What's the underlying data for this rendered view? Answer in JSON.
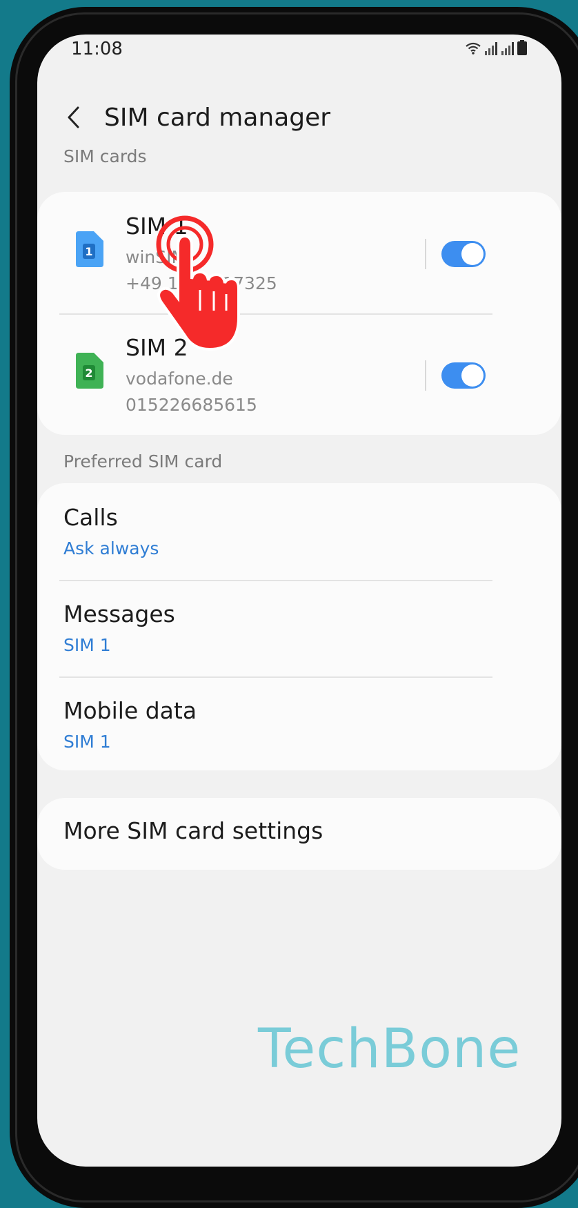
{
  "status_bar": {
    "time": "11:08",
    "icons": [
      "wifi-icon",
      "signal-icon",
      "signal-icon",
      "battery-icon"
    ]
  },
  "app_bar": {
    "title": "SIM card manager",
    "back_icon": "chevron-left-icon"
  },
  "sections": {
    "sim_cards": "SIM cards",
    "preferred": "Preferred SIM card"
  },
  "sims": [
    {
      "title": "SIM 1",
      "carrier": "winSIM",
      "number": "+49 1514617325",
      "badge": "1",
      "color": "#3d8ef0",
      "enabled": true
    },
    {
      "title": "SIM 2",
      "carrier": "vodafone.de",
      "number": "015226685615",
      "badge": "2",
      "color": "#34a853",
      "enabled": true
    }
  ],
  "preferred": [
    {
      "title": "Calls",
      "value": "Ask always"
    },
    {
      "title": "Messages",
      "value": "SIM 1"
    },
    {
      "title": "Mobile data",
      "value": "SIM 1"
    }
  ],
  "more": {
    "title": "More SIM card settings"
  },
  "watermark": "TechBone",
  "colors": {
    "accent": "#3d8ef0",
    "link": "#2f7dd4",
    "tap_indicator": "#f52a2a",
    "background": "#137a8a"
  }
}
